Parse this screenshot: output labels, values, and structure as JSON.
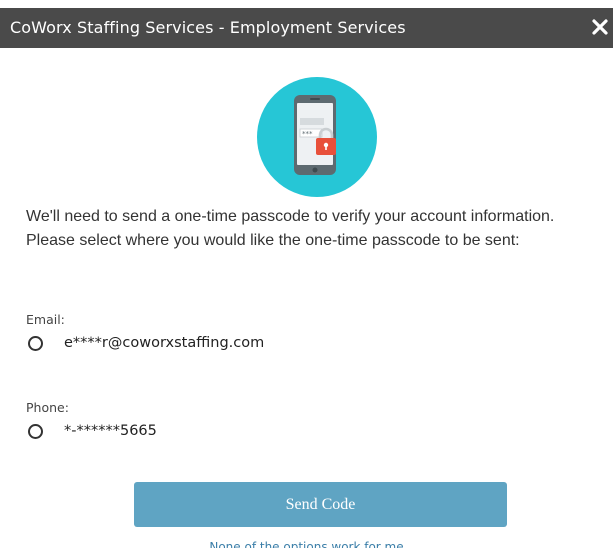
{
  "dialog": {
    "title": "CoWorx Staffing Services - Employment Services",
    "close_icon": "close-icon"
  },
  "hero": {
    "icon": "phone-lock-icon",
    "colors": {
      "circle": "#26c6d6",
      "lock": "#e8503a"
    }
  },
  "intro": {
    "text": "We'll need to send a one-time passcode to verify your account information. Please select where you would like the one-time passcode to be sent:"
  },
  "options": [
    {
      "label": "Email:",
      "value": "e****r@coworxstaffing.com",
      "selected": false
    },
    {
      "label": "Phone:",
      "value": "*-******5665",
      "selected": false
    }
  ],
  "actions": {
    "send_label": "Send Code",
    "send_color": "#5fa4c3",
    "more_link": "None of the options work for me"
  }
}
